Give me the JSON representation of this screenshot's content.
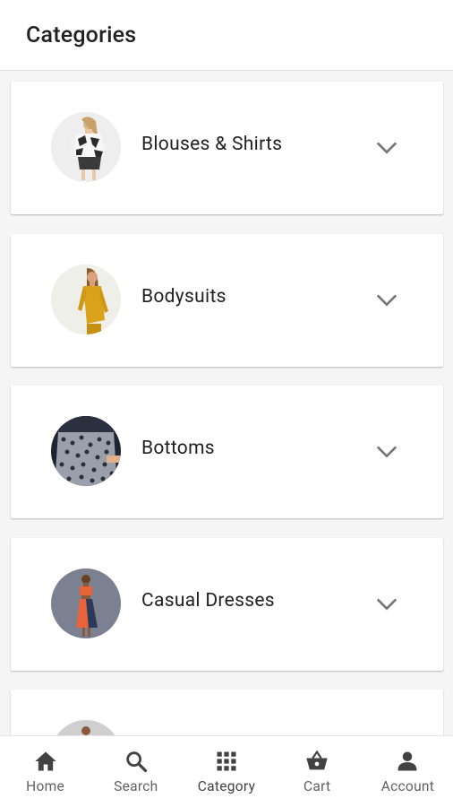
{
  "app_bar": {
    "title": "Categories"
  },
  "categories": [
    {
      "label": "Blouses & Shirts",
      "icon": "chevron-down-icon"
    },
    {
      "label": "Bodysuits",
      "icon": "chevron-down-icon"
    },
    {
      "label": "Bottoms",
      "icon": "chevron-down-icon"
    },
    {
      "label": "Casual Dresses",
      "icon": "chevron-down-icon"
    },
    {
      "label": "",
      "icon": ""
    }
  ],
  "bottom_nav": {
    "items": [
      {
        "label": "Home",
        "icon": "home-icon"
      },
      {
        "label": "Search",
        "icon": "search-icon"
      },
      {
        "label": "Category",
        "icon": "grid-icon",
        "active": true
      },
      {
        "label": "Cart",
        "icon": "basket-icon"
      },
      {
        "label": "Account",
        "icon": "person-icon"
      }
    ]
  },
  "colors": {
    "background": "#f5f5f5",
    "card": "#ffffff",
    "text": "#212121",
    "icon": "#424242",
    "chevron": "#757575"
  }
}
